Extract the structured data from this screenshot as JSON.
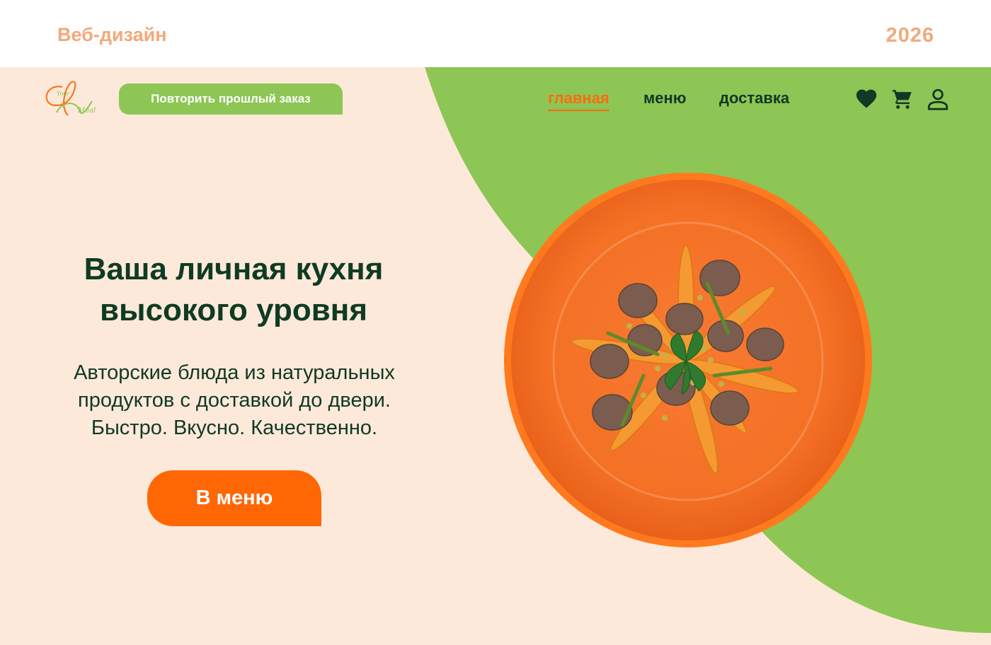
{
  "header": {
    "left_label": "Веб-дизайн",
    "year": "2026"
  },
  "logo": {
    "text_top": "Your",
    "text_bottom": "Meal"
  },
  "repeat_button": {
    "label": "Повторить прошлый заказ"
  },
  "nav": {
    "items": [
      {
        "label": "главная",
        "active": true
      },
      {
        "label": "меню",
        "active": false
      },
      {
        "label": "доставка",
        "active": false
      }
    ]
  },
  "icons": {
    "favorites": "heart-icon",
    "cart": "cart-icon",
    "account": "user-icon"
  },
  "hero": {
    "headline_line1": "Ваша личная кухня",
    "headline_line2": "высокого уровня",
    "sub_line1": "Авторские блюда из натуральных",
    "sub_line2": "продуктов с доставкой до двери.",
    "sub_line3": "Быстро. Вкусно. Качественно.",
    "cta_label": "В меню"
  },
  "colors": {
    "accent_orange": "#ff6705",
    "brand_green": "#8dc654",
    "hero_background": "#fde9d9",
    "text_dark_green": "#0f3b22",
    "header_peach": "#f2a97b"
  }
}
